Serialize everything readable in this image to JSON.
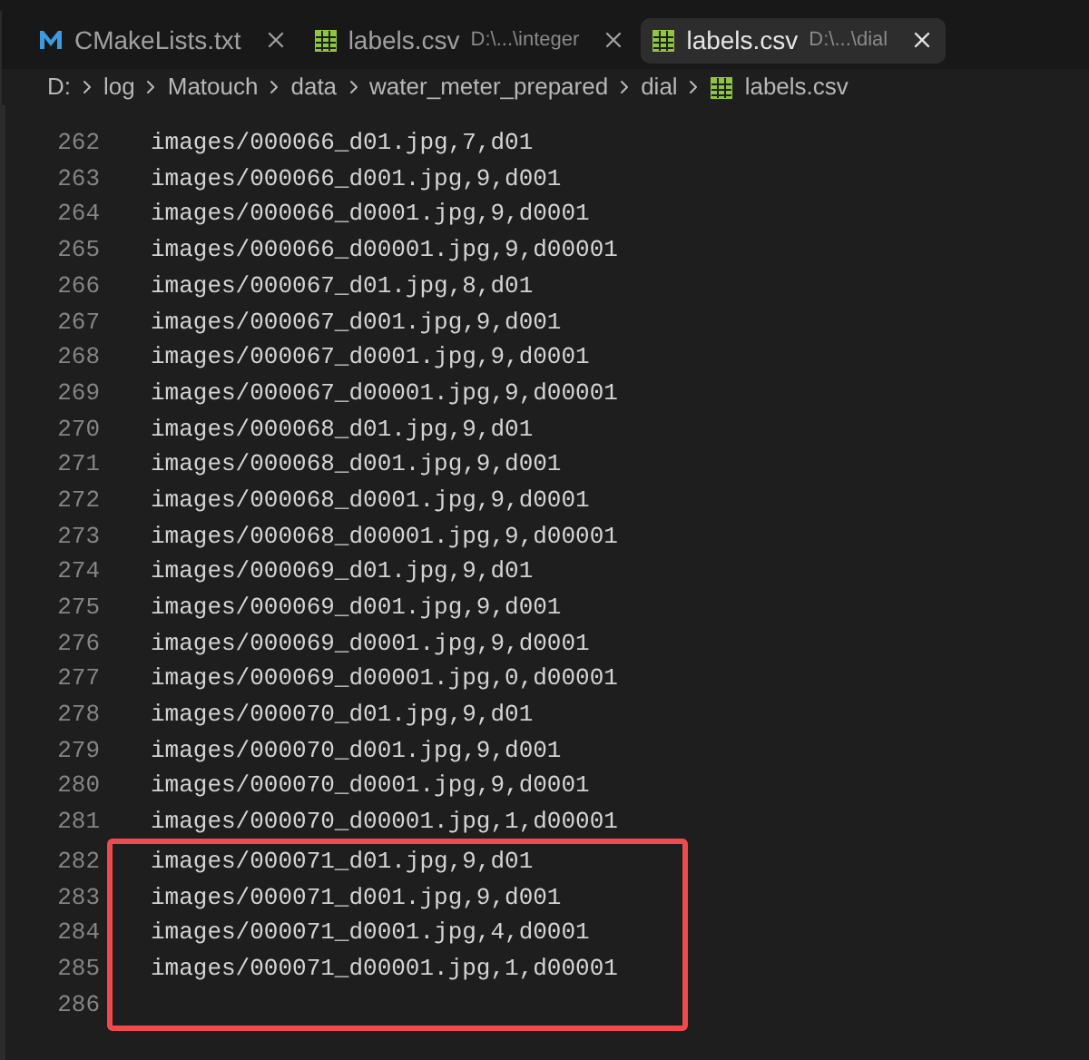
{
  "tabs": [
    {
      "kind": "cmake",
      "label": "CMakeLists.txt",
      "selected": false
    },
    {
      "kind": "csv",
      "label": "labels.csv",
      "description": "D:\\...\\integer",
      "selected": false
    },
    {
      "kind": "csv",
      "label": "labels.csv",
      "description": "D:\\...\\dial",
      "selected": true
    }
  ],
  "breadcrumb": [
    {
      "label": "D:"
    },
    {
      "label": "log"
    },
    {
      "label": "Matouch"
    },
    {
      "label": "data"
    },
    {
      "label": "water_meter_prepared"
    },
    {
      "label": "dial"
    },
    {
      "label": "labels.csv",
      "kind": "csv"
    }
  ],
  "lines": [
    {
      "number": "262",
      "text": "images/000066_d01.jpg,7,d01",
      "highlighted": false
    },
    {
      "number": "263",
      "text": "images/000066_d001.jpg,9,d001",
      "highlighted": false
    },
    {
      "number": "264",
      "text": "images/000066_d0001.jpg,9,d0001",
      "highlighted": false
    },
    {
      "number": "265",
      "text": "images/000066_d00001.jpg,9,d00001",
      "highlighted": false
    },
    {
      "number": "266",
      "text": "images/000067_d01.jpg,8,d01",
      "highlighted": false
    },
    {
      "number": "267",
      "text": "images/000067_d001.jpg,9,d001",
      "highlighted": false
    },
    {
      "number": "268",
      "text": "images/000067_d0001.jpg,9,d0001",
      "highlighted": false
    },
    {
      "number": "269",
      "text": "images/000067_d00001.jpg,9,d00001",
      "highlighted": false
    },
    {
      "number": "270",
      "text": "images/000068_d01.jpg,9,d01",
      "highlighted": false
    },
    {
      "number": "271",
      "text": "images/000068_d001.jpg,9,d001",
      "highlighted": false
    },
    {
      "number": "272",
      "text": "images/000068_d0001.jpg,9,d0001",
      "highlighted": false
    },
    {
      "number": "273",
      "text": "images/000068_d00001.jpg,9,d00001",
      "highlighted": false
    },
    {
      "number": "274",
      "text": "images/000069_d01.jpg,9,d01",
      "highlighted": false
    },
    {
      "number": "275",
      "text": "images/000069_d001.jpg,9,d001",
      "highlighted": false
    },
    {
      "number": "276",
      "text": "images/000069_d0001.jpg,9,d0001",
      "highlighted": false
    },
    {
      "number": "277",
      "text": "images/000069_d00001.jpg,0,d00001",
      "highlighted": false
    },
    {
      "number": "278",
      "text": "images/000070_d01.jpg,9,d01",
      "highlighted": false
    },
    {
      "number": "279",
      "text": "images/000070_d001.jpg,9,d001",
      "highlighted": false
    },
    {
      "number": "280",
      "text": "images/000070_d0001.jpg,9,d0001",
      "highlighted": false
    },
    {
      "number": "281",
      "text": "images/000070_d00001.jpg,1,d00001",
      "highlighted": false
    },
    {
      "number": "282",
      "text": "images/000071_d01.jpg,9,d01",
      "highlighted": true
    },
    {
      "number": "283",
      "text": "images/000071_d001.jpg,9,d001",
      "highlighted": true
    },
    {
      "number": "284",
      "text": "images/000071_d0001.jpg,4,d0001",
      "highlighted": true
    },
    {
      "number": "285",
      "text": "images/000071_d00001.jpg,1,d00001",
      "highlighted": true
    },
    {
      "number": "286",
      "highlighted": true
    }
  ]
}
